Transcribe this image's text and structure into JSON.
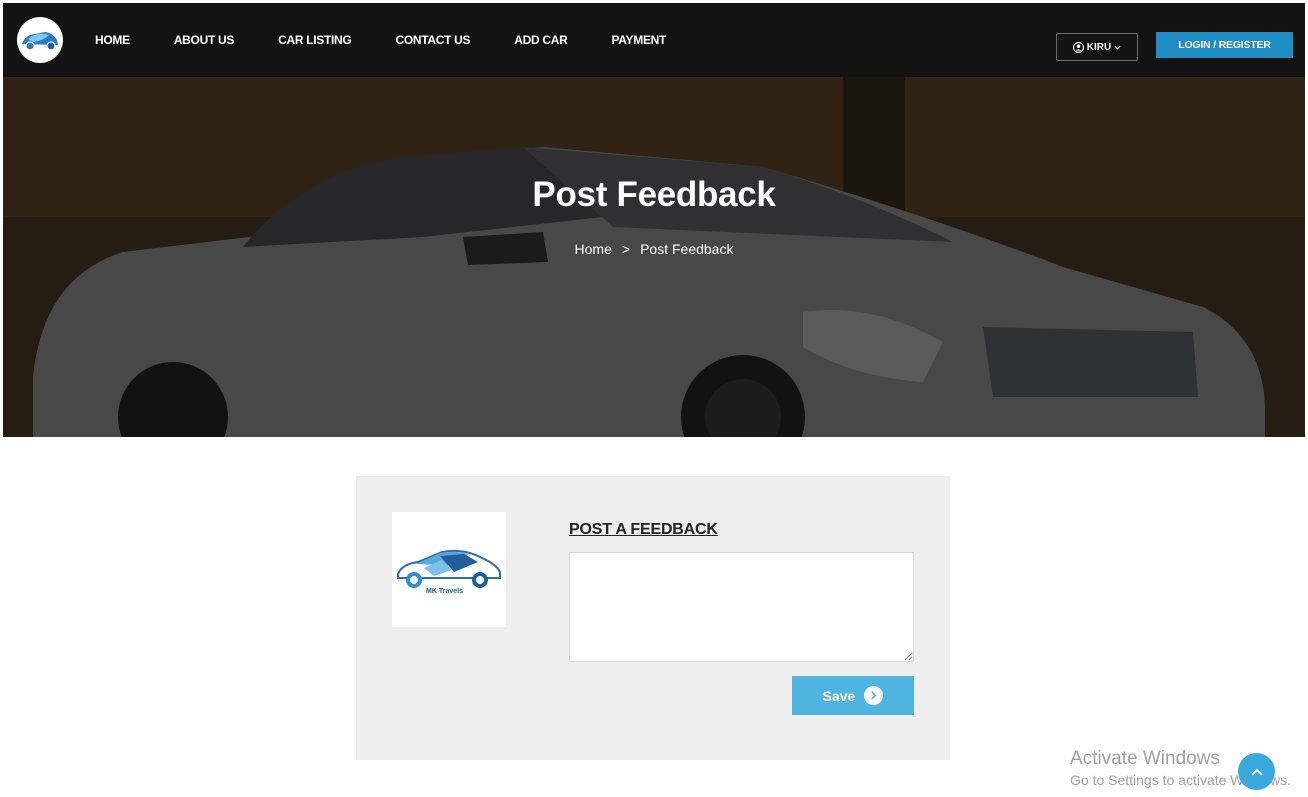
{
  "nav": {
    "items": [
      "HOME",
      "ABOUT US",
      "CAR LISTING",
      "CONTACT US",
      "ADD CAR",
      "PAYMENT"
    ],
    "user_label": "KIRU",
    "login_label": "LOGIN / REGISTER",
    "logo_icon": "car-handshake-logo"
  },
  "hero": {
    "title": "Post Feedback",
    "breadcrumb": [
      "Home",
      "Post Feedback"
    ],
    "separator": ">"
  },
  "feedback": {
    "heading": "POST A FEEDBACK",
    "textarea_value": "",
    "save_label": "Save",
    "logo_text": "MK Travels"
  },
  "watermark": {
    "line1": "Activate Windows",
    "line2": "Go to Settings to activate Windows."
  },
  "colors": {
    "nav_bg": "#131313",
    "login_btn": "#1f8ec4",
    "save_btn": "#4fb4e0",
    "box_bg": "#eeeeee"
  }
}
